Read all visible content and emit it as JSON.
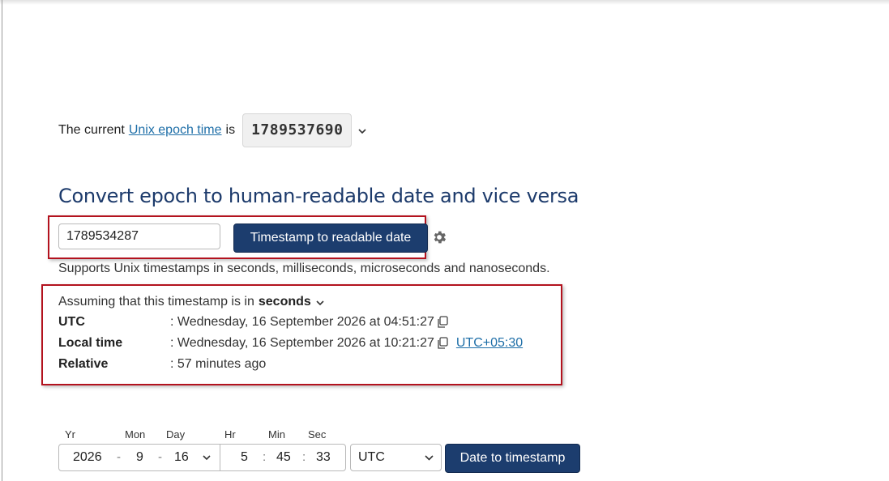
{
  "current": {
    "prefix": "The current",
    "link_text": "Unix epoch time",
    "suffix": "is",
    "epoch_value": "1789537690"
  },
  "title": "Convert epoch to human-readable date and vice versa",
  "converter": {
    "input_value": "1789534287",
    "button_label": "Timestamp to readable date",
    "supports_text": "Supports Unix timestamps in seconds, milliseconds, microseconds and nanoseconds."
  },
  "result": {
    "assume_prefix": "Assuming that this timestamp is in",
    "assume_unit": "seconds",
    "rows": [
      {
        "label": "UTC",
        "value": ": Wednesday, 16 September 2026 at 04:51:27"
      },
      {
        "label": "Local time",
        "value": ": Wednesday, 16 September 2026 at 10:21:27",
        "tz_link": "UTC+05:30"
      },
      {
        "label": "Relative",
        "value": ": 57 minutes ago"
      }
    ]
  },
  "date_to_ts": {
    "labels": {
      "yr": "Yr",
      "mon": "Mon",
      "day": "Day",
      "hr": "Hr",
      "min": "Min",
      "sec": "Sec"
    },
    "values": {
      "yr": "2026",
      "mon": "9",
      "day": "16",
      "hr": "5",
      "min": "45",
      "sec": "33"
    },
    "timezone": "UTC",
    "button_label": "Date to timestamp"
  },
  "colors": {
    "accent": "#1c3d6e",
    "link": "#1f6fa8",
    "highlight_border": "#b3121e"
  },
  "icons": [
    "chevron-down-icon",
    "gear-icon",
    "copy-icon"
  ]
}
